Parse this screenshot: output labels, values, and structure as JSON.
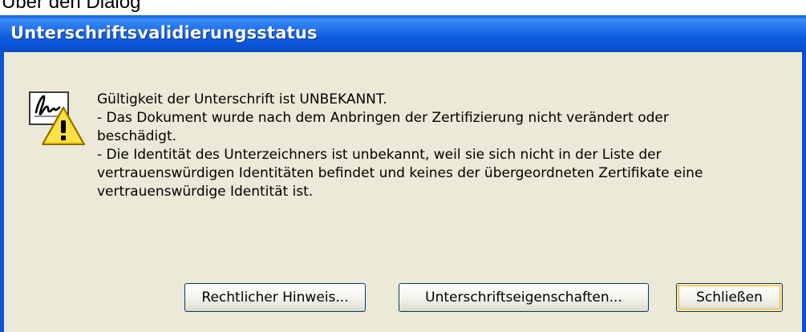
{
  "page": {
    "heading": "Über den Dialog"
  },
  "dialog": {
    "title": "Unterschriftsvalidierungsstatus",
    "icon": "signature-warning-icon",
    "message_lines": [
      "Gültigkeit der Unterschrift ist UNBEKANNT.",
      "- Das Dokument wurde nach dem Anbringen der Zertifizierung nicht verändert oder",
      "beschädigt.",
      "- Die Identität des Unterzeichners ist unbekannt, weil sie sich nicht in der Liste der",
      "vertrauenswürdigen Identitäten befindet und keines der übergeordneten Zertifikate eine",
      "vertrauenswürdige Identität ist."
    ],
    "buttons": {
      "legal_notice": "Rechtlicher Hinweis...",
      "signature_properties": "Unterschriftseigenschaften...",
      "close": "Schließen"
    }
  },
  "colors": {
    "titlebar": "#0a53d2",
    "client_background": "#ece9d8",
    "warning_yellow": "#ffd400"
  }
}
